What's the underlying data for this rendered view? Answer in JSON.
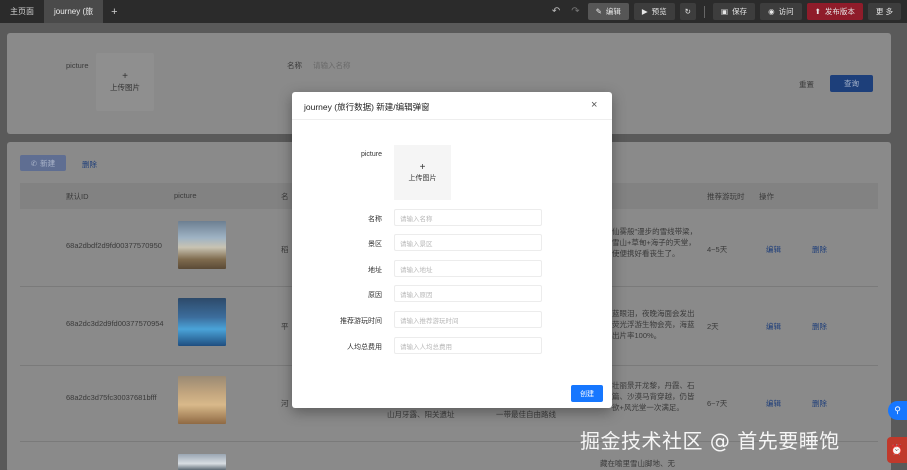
{
  "tabs": [
    {
      "label": "主页面"
    },
    {
      "label": "journey (旅"
    },
    {
      "label": "+"
    }
  ],
  "toolbar": {
    "edit": "编辑",
    "preview": "预览",
    "save": "保存",
    "visit": "访问",
    "publish": "发布版本",
    "more": "更 多"
  },
  "search": {
    "picture_label": "picture",
    "upload_label": "上传图片",
    "name_label": "名称",
    "name_placeholder": "请输入名称",
    "reset": "重置",
    "query": "查询"
  },
  "table": {
    "new_button": "新建",
    "delete_button": "删除",
    "columns": [
      "默认ID",
      "picture",
      "名",
      "",
      "",
      "",
      "推荐游玩时",
      "操作"
    ],
    "rows": [
      {
        "id": "68a2dbdf2d9fd00377570950",
        "desc": "仙雾般\"漫步的雪线带梁，雪山+草甸+海子的天堂，使便携好看丧生了。",
        "duration": "4~5天",
        "edit": "编辑",
        "delete": "删除",
        "name": "稻"
      },
      {
        "id": "68a2dc3d2d9fd00377570954",
        "desc": "蓝眼泪，夜晚海面会发出荧光浮游生物会亮，海蓝出片率100%。",
        "duration": "2天",
        "edit": "编辑",
        "delete": "删除",
        "name": "平"
      },
      {
        "id": "68a2dc3d75fc30037681bfff",
        "desc": "壮丽景开龙黎，丹霞、石篇、沙漠马背穿越，仍皆欲+风光堂一次满足。",
        "duration": "6~7天",
        "edit": "编辑",
        "delete": "删除",
        "name": "河"
      }
    ],
    "extra": [
      "山月牙露、阳关遗址",
      "一带最佳自由路线",
      "藏在喻里雪山脚地、无"
    ]
  },
  "modal": {
    "title": "journey (旅行数据) 新建/编辑弹窗",
    "close_icon": "×",
    "fields": [
      {
        "label": "picture",
        "type": "upload",
        "upload_label": "上传图片"
      },
      {
        "label": "名称",
        "placeholder": "请输入名称"
      },
      {
        "label": "景区",
        "placeholder": "请输入景区"
      },
      {
        "label": "地址",
        "placeholder": "请输入地址"
      },
      {
        "label": "原因",
        "placeholder": "请输入原因"
      },
      {
        "label": "推荐游玩时间",
        "placeholder": "请输入推荐游玩时间"
      },
      {
        "label": "人均总费用",
        "placeholder": "请输入人均总费用"
      }
    ],
    "create_button": "创建"
  },
  "watermark": "掘金技术社区 @ 首先要睡饱",
  "colors": {
    "primary": "#1677ff",
    "publish": "#8f1c2a",
    "topbar": "#2b2b2b"
  }
}
